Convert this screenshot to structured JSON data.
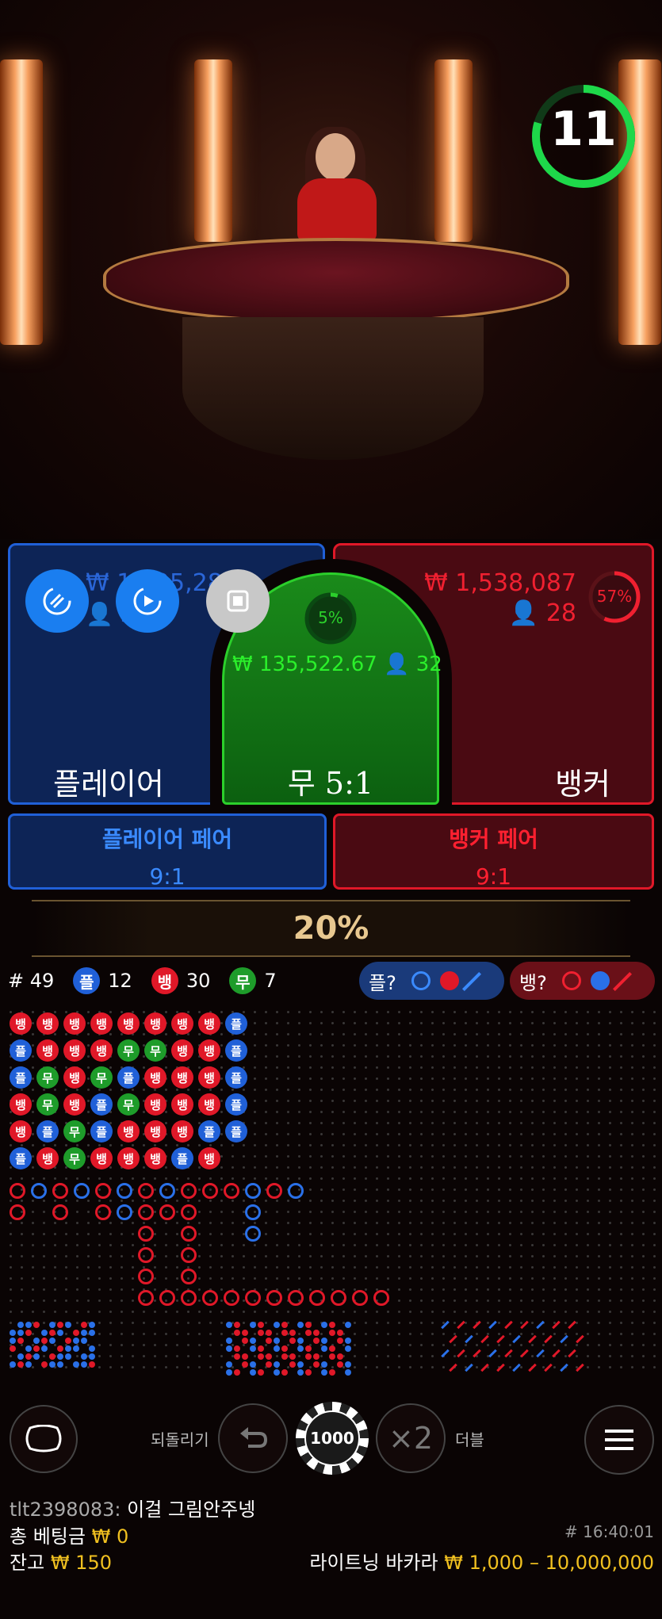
{
  "timer": {
    "value": "11"
  },
  "player": {
    "amount": "₩ 1,125,28",
    "bettors": "3",
    "label": "플레이어",
    "buttons": [
      "autoplay-icon",
      "replay-icon",
      "stop-icon"
    ]
  },
  "tie": {
    "percent": "5%",
    "amount": "₩ 135,522.67",
    "bettors": "32",
    "label": "무 5:1"
  },
  "banker": {
    "amount": "₩ 1,538,087",
    "bettors": "28",
    "percent": "57%",
    "label": "뱅커"
  },
  "player_pair": {
    "title": "플레이어 페어",
    "odds": "9:1"
  },
  "banker_pair": {
    "title": "뱅커 페어",
    "odds": "9:1"
  },
  "multiplier": "20%",
  "stats": {
    "total_label": "# 49",
    "player_badge": "플",
    "player_count": "12",
    "banker_badge": "뱅",
    "banker_count": "30",
    "tie_badge": "무",
    "tie_count": "7"
  },
  "predict": {
    "player_label": "플?",
    "banker_label": "뱅?"
  },
  "bead_road": [
    [
      "뱅",
      "플",
      "플",
      "뱅",
      "뱅",
      "플"
    ],
    [
      "뱅",
      "뱅",
      "무",
      "무",
      "플",
      "뱅"
    ],
    [
      "뱅",
      "뱅",
      "뱅",
      "뱅",
      "무",
      "무"
    ],
    [
      "뱅",
      "뱅",
      "무",
      "플",
      "플",
      "뱅"
    ],
    [
      "뱅",
      "무",
      "플",
      "무",
      "뱅",
      "뱅"
    ],
    [
      "뱅",
      "무",
      "뱅",
      "뱅",
      "뱅",
      "뱅"
    ],
    [
      "뱅",
      "뱅",
      "뱅",
      "뱅",
      "뱅",
      "플"
    ],
    [
      "뱅",
      "뱅",
      "뱅",
      "뱅",
      "플",
      "뱅"
    ],
    [
      "플",
      "플",
      "플",
      "플",
      "플",
      ""
    ]
  ],
  "controls": {
    "undo_label": "되돌리기",
    "chip_value": "1000",
    "double_symbol": "×2",
    "double_label": "더블"
  },
  "chat": {
    "user": "tlt2398083:",
    "message": "이걸 그림안주넹"
  },
  "footer": {
    "total_bet_label": "총 베팅금",
    "total_bet_value": "₩ 0",
    "balance_label": "잔고",
    "balance_value": "₩ 150",
    "game_id": "# 16:40:01",
    "game_name": "라이트닝 바카라",
    "limits": "₩ 1,000 – 10,000,000"
  },
  "colors": {
    "player": "#2060d8",
    "banker": "#e01828",
    "tie": "#1e9c2a",
    "gold": "#f0c020"
  }
}
